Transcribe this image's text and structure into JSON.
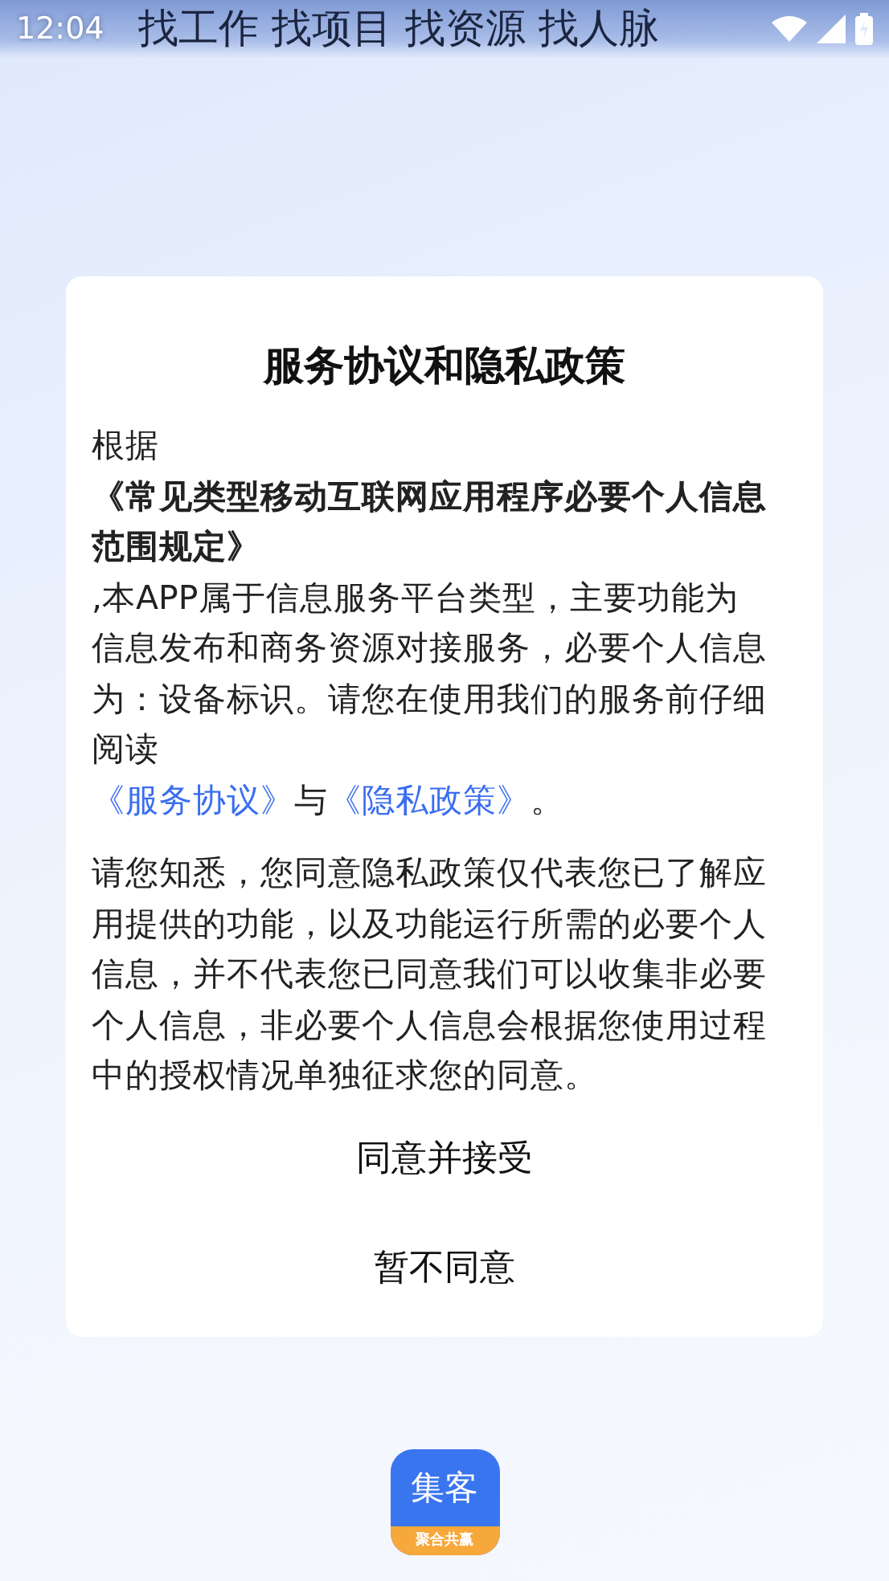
{
  "status_bar": {
    "time": "12:04"
  },
  "headline": "找工作 找项目 找资源 找人脉",
  "dialog": {
    "title": "服务协议和隐私政策",
    "paragraph_1": [
      {
        "kind": "plain",
        "text": "根据"
      },
      {
        "kind": "bold",
        "text": "《常见类型移动互联网应用程序必要个人信息范围规定》"
      },
      {
        "kind": "plain",
        "text": ",本APP属于信息服务平台类型，主要功能为信息发布和商务资源对接服务，必要个人信息为：设备标识。请您在使用我们的服务前仔细阅读"
      }
    ],
    "links_line": {
      "link_1": "《服务协议》",
      "joiner": "与",
      "link_2": "《隐私政策》",
      "end": "。"
    },
    "paragraph_2": "请您知悉，您同意隐私政策仅代表您已了解应用提供的功能，以及功能运行所需的必要个人信息，并不代表您已同意我们可以收集非必要个人信息，非必要个人信息会根据您使用过程中的授权情况单独征求您的同意。",
    "buttons": [
      "同意并接受",
      "暂不同意"
    ]
  },
  "app_logo": {
    "name": "集客",
    "slogan": "聚合共赢"
  }
}
